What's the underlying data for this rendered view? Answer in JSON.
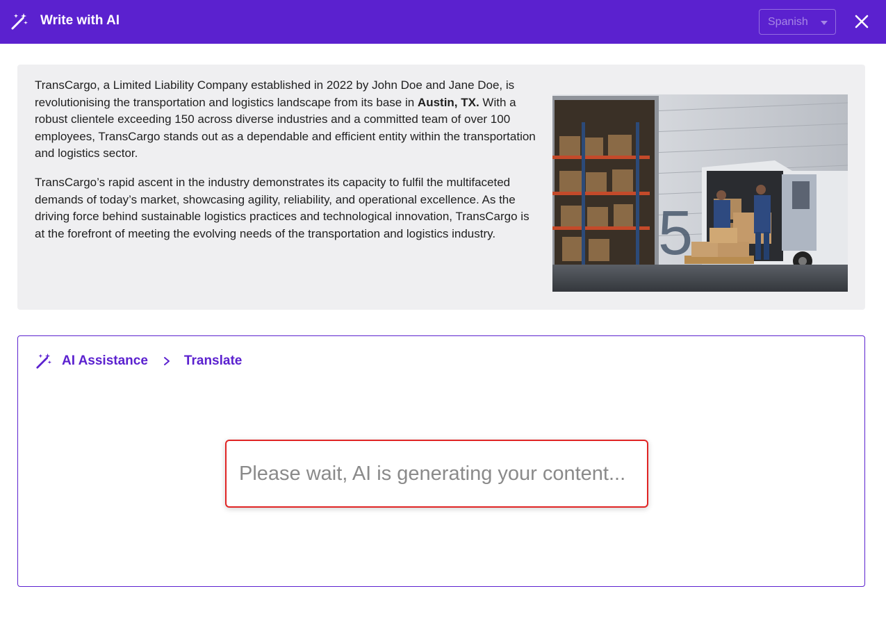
{
  "header": {
    "title": "Write with AI",
    "language_select": {
      "selected": "Spanish"
    },
    "icons": {
      "wand": "magic-wand-icon",
      "close": "close-icon"
    }
  },
  "content": {
    "paragraph1_part1": "TransCargo, a Limited Liability Company established in 2022 by John Doe and Jane Doe, is revolutionising the transportation and logistics landscape from its base in ",
    "paragraph1_bold": "Austin, TX.",
    "paragraph1_part2": " With a robust clientele exceeding 150 across diverse industries and a committed team of over 100 employees, TransCargo stands out as a dependable and efficient entity within the transportation and logistics sector.",
    "paragraph2": "TransCargo’s rapid ascent in the industry demonstrates its capacity to fulfil the multifaceted demands of today’s market, showcasing agility, reliability, and operational excellence. As the driving force behind sustainable logistics practices and technological innovation, TransCargo is at the forefront of meeting the evolving needs of the transportation and logistics industry.",
    "image": "warehouse-van-loading-photo"
  },
  "assistance": {
    "breadcrumb": [
      "AI Assistance",
      "Translate"
    ],
    "loading_message": "Please wait, AI is generating your content..."
  },
  "colors": {
    "brand": "#5b21cf",
    "card_bg": "#efeff1",
    "alert_border": "#e02424",
    "placeholder_text": "#8a8a8a"
  }
}
